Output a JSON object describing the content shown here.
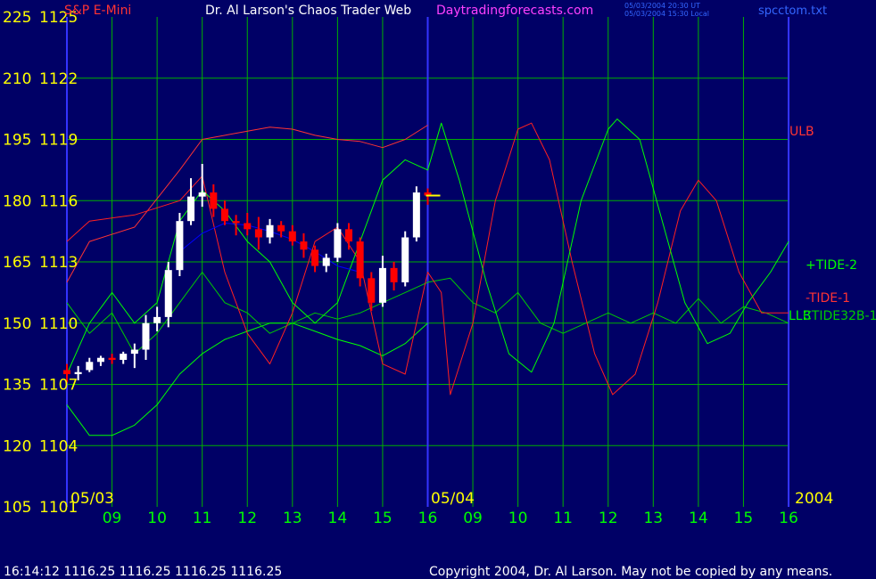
{
  "header": {
    "instrument": "S&P E-Mini",
    "site_title": "Dr. Al Larson's Chaos Trader Web",
    "site_link": "Daytradingforecasts.com",
    "stamp_line1": "05/03/2004 20:30 UT",
    "stamp_line2": "05/03/2004 15:30 Local",
    "file_name": "spcctom.txt"
  },
  "footer": {
    "quote": "16:14:12  1116.25 1116.25 1116.25 1116.25",
    "copyright": "Copyright 2004, Dr. Al Larson. May not be copied by any means."
  },
  "colors": {
    "background": "#000066",
    "grid": "#00b000",
    "divider": "#3333ff",
    "axis_text": "#ffff00",
    "hour_labels": "#00ff00",
    "ulb": "#ff3333",
    "tide_fast": "#00ff00",
    "tide_slow": "#ff2020",
    "cycle": "#00cc00",
    "bars_up": "#ffffff",
    "bars_down": "#ff0000",
    "average": "#0000ff"
  },
  "chart_data": {
    "type": "line",
    "left_axis_labels": [
      "225",
      "210",
      "195",
      "180",
      "165",
      "150",
      "135",
      "120",
      "105"
    ],
    "price_axis_labels": [
      "1125",
      "1122",
      "1119",
      "1116",
      "1113",
      "1110",
      "1107",
      "1104",
      "1101"
    ],
    "price_range": [
      1101,
      1125
    ],
    "hour_labels": [
      "09",
      "10",
      "11",
      "12",
      "13",
      "14",
      "15",
      "16",
      "09",
      "10",
      "11",
      "12",
      "13",
      "14",
      "15",
      "16"
    ],
    "date_labels": [
      "05/03",
      "05/04"
    ],
    "year_label": "2004",
    "series_labels": [
      "ULB",
      "+TIDE-2",
      "-TIDE-1",
      "LLB",
      "CTIDE32B-1"
    ],
    "last_price": 1116.25,
    "bars": [
      {
        "t": 8.0,
        "o": 1107.7,
        "h": 1108.0,
        "l": 1107.1,
        "c": 1107.5
      },
      {
        "t": 8.25,
        "o": 1107.5,
        "h": 1107.9,
        "l": 1107.2,
        "c": 1107.6
      },
      {
        "t": 8.5,
        "o": 1107.7,
        "h": 1108.3,
        "l": 1107.6,
        "c": 1108.1
      },
      {
        "t": 8.75,
        "o": 1108.1,
        "h": 1108.4,
        "l": 1107.9,
        "c": 1108.3
      },
      {
        "t": 9.0,
        "o": 1108.3,
        "h": 1108.5,
        "l": 1108.0,
        "c": 1108.2
      },
      {
        "t": 9.25,
        "o": 1108.2,
        "h": 1108.6,
        "l": 1108.0,
        "c": 1108.5
      },
      {
        "t": 9.5,
        "o": 1108.5,
        "h": 1109.0,
        "l": 1107.8,
        "c": 1108.7
      },
      {
        "t": 9.75,
        "o": 1108.7,
        "h": 1110.4,
        "l": 1108.2,
        "c": 1110.0
      },
      {
        "t": 10.0,
        "o": 1110.0,
        "h": 1110.8,
        "l": 1109.6,
        "c": 1110.3
      },
      {
        "t": 10.25,
        "o": 1110.3,
        "h": 1113.0,
        "l": 1109.8,
        "c": 1112.6
      },
      {
        "t": 10.5,
        "o": 1112.6,
        "h": 1115.4,
        "l": 1112.3,
        "c": 1115.0
      },
      {
        "t": 10.75,
        "o": 1115.0,
        "h": 1117.1,
        "l": 1114.8,
        "c": 1116.2
      },
      {
        "t": 11.0,
        "o": 1116.2,
        "h": 1117.8,
        "l": 1115.7,
        "c": 1116.4
      },
      {
        "t": 11.25,
        "o": 1116.4,
        "h": 1116.8,
        "l": 1115.2,
        "c": 1115.6
      },
      {
        "t": 11.5,
        "o": 1115.6,
        "h": 1116.0,
        "l": 1114.8,
        "c": 1115.0
      },
      {
        "t": 11.75,
        "o": 1115.0,
        "h": 1115.3,
        "l": 1114.3,
        "c": 1114.9
      },
      {
        "t": 12.0,
        "o": 1114.9,
        "h": 1115.4,
        "l": 1114.3,
        "c": 1114.6
      },
      {
        "t": 12.25,
        "o": 1114.6,
        "h": 1115.2,
        "l": 1113.6,
        "c": 1114.2
      },
      {
        "t": 12.5,
        "o": 1114.2,
        "h": 1115.1,
        "l": 1113.9,
        "c": 1114.8
      },
      {
        "t": 12.75,
        "o": 1114.8,
        "h": 1115.0,
        "l": 1114.2,
        "c": 1114.5
      },
      {
        "t": 13.0,
        "o": 1114.5,
        "h": 1114.8,
        "l": 1113.8,
        "c": 1114.0
      },
      {
        "t": 13.25,
        "o": 1114.0,
        "h": 1114.4,
        "l": 1113.2,
        "c": 1113.6
      },
      {
        "t": 13.5,
        "o": 1113.6,
        "h": 1113.8,
        "l": 1112.5,
        "c": 1112.8
      },
      {
        "t": 13.75,
        "o": 1112.8,
        "h": 1113.4,
        "l": 1112.5,
        "c": 1113.2
      },
      {
        "t": 14.0,
        "o": 1113.2,
        "h": 1114.9,
        "l": 1113.0,
        "c": 1114.6
      },
      {
        "t": 14.25,
        "o": 1114.6,
        "h": 1114.9,
        "l": 1113.6,
        "c": 1114.0
      },
      {
        "t": 14.5,
        "o": 1114.0,
        "h": 1114.2,
        "l": 1111.8,
        "c": 1112.2
      },
      {
        "t": 14.75,
        "o": 1112.2,
        "h": 1112.5,
        "l": 1110.6,
        "c": 1111.0
      },
      {
        "t": 15.0,
        "o": 1111.0,
        "h": 1113.3,
        "l": 1110.8,
        "c": 1112.7
      },
      {
        "t": 15.25,
        "o": 1112.7,
        "h": 1113.0,
        "l": 1111.6,
        "c": 1112.0
      },
      {
        "t": 15.5,
        "o": 1112.0,
        "h": 1114.5,
        "l": 1111.8,
        "c": 1114.2
      },
      {
        "t": 15.75,
        "o": 1114.2,
        "h": 1116.7,
        "l": 1114.0,
        "c": 1116.4
      },
      {
        "t": 16.0,
        "o": 1116.4,
        "h": 1116.6,
        "l": 1115.8,
        "c": 1116.25
      }
    ],
    "upper_band": [
      [
        8,
        1112
      ],
      [
        8.5,
        1114
      ],
      [
        9.5,
        1114.7
      ],
      [
        10.5,
        1117.5
      ],
      [
        11,
        1119
      ],
      [
        12,
        1119.4
      ],
      [
        12.5,
        1119.6
      ],
      [
        13,
        1119.5
      ],
      [
        13.5,
        1119.2
      ],
      [
        14,
        1119.0
      ],
      [
        14.5,
        1118.9
      ],
      [
        15,
        1118.6
      ],
      [
        15.5,
        1119
      ],
      [
        16,
        1119.7
      ]
    ],
    "lower_band": [
      [
        8,
        1106
      ],
      [
        8.5,
        1104.5
      ],
      [
        9,
        1104.5
      ],
      [
        9.5,
        1105
      ],
      [
        10,
        1106
      ],
      [
        10.5,
        1107.5
      ],
      [
        11,
        1108.5
      ],
      [
        11.5,
        1109.2
      ],
      [
        12,
        1109.6
      ],
      [
        12.5,
        1110
      ],
      [
        13,
        1110
      ],
      [
        13.5,
        1109.6
      ],
      [
        14,
        1109.2
      ],
      [
        14.5,
        1108.9
      ],
      [
        15,
        1108.4
      ],
      [
        15.5,
        1109
      ],
      [
        16,
        1110
      ]
    ],
    "fast_tide": [
      [
        8,
        1107.5
      ],
      [
        8.5,
        1110
      ],
      [
        9,
        1111.5
      ],
      [
        9.5,
        1110
      ],
      [
        10,
        1111
      ],
      [
        10.5,
        1115
      ],
      [
        11,
        1116.5
      ],
      [
        11.5,
        1115.5
      ],
      [
        12,
        1114
      ],
      [
        12.5,
        1113
      ],
      [
        13,
        1111
      ],
      [
        13.5,
        1110
      ],
      [
        14,
        1111
      ],
      [
        14.5,
        1114
      ],
      [
        15,
        1117
      ],
      [
        15.5,
        1118
      ],
      [
        16,
        1117.5
      ],
      [
        16.3,
        1119.8
      ],
      [
        16.7,
        1117
      ],
      [
        17.3,
        1112
      ],
      [
        17.8,
        1108.5
      ],
      [
        18.3,
        1107.6
      ],
      [
        18.8,
        1110
      ],
      [
        19.4,
        1116
      ],
      [
        20,
        1119.5
      ],
      [
        20.2,
        1120
      ],
      [
        20.7,
        1119
      ],
      [
        21.2,
        1115
      ],
      [
        21.7,
        1111
      ],
      [
        22.2,
        1109
      ],
      [
        22.7,
        1109.5
      ],
      [
        23.1,
        1111
      ],
      [
        23.6,
        1112.5
      ],
      [
        24,
        1114
      ]
    ],
    "slow_tide": [
      [
        8,
        1114
      ],
      [
        8.5,
        1115
      ],
      [
        9.5,
        1115.3
      ],
      [
        10.5,
        1116
      ],
      [
        11,
        1117.2
      ],
      [
        11.5,
        1112.5
      ],
      [
        12,
        1109.5
      ],
      [
        12.5,
        1108
      ],
      [
        13,
        1110.5
      ],
      [
        13.5,
        1114
      ],
      [
        14,
        1114.7
      ],
      [
        14.5,
        1113
      ],
      [
        15,
        1108
      ],
      [
        15.5,
        1107.5
      ],
      [
        16,
        1112.5
      ],
      [
        16.3,
        1111.5
      ],
      [
        16.5,
        1106.5
      ],
      [
        17,
        1110
      ],
      [
        17.5,
        1116
      ],
      [
        18,
        1119.5
      ],
      [
        18.3,
        1119.8
      ],
      [
        18.7,
        1118
      ],
      [
        19.2,
        1113
      ],
      [
        19.7,
        1108.5
      ],
      [
        20.1,
        1106.5
      ],
      [
        20.6,
        1107.5
      ],
      [
        21.1,
        1111
      ],
      [
        21.6,
        1115.5
      ],
      [
        22,
        1117
      ],
      [
        22.4,
        1116
      ],
      [
        22.9,
        1112.5
      ],
      [
        23.4,
        1110.5
      ],
      [
        24,
        1110.5
      ]
    ],
    "cycle_line": [
      [
        8,
        1111
      ],
      [
        8.5,
        1109.5
      ],
      [
        9,
        1110.5
      ],
      [
        9.5,
        1108.5
      ],
      [
        10,
        1109.5
      ],
      [
        10.5,
        1111
      ],
      [
        11,
        1112.5
      ],
      [
        11.5,
        1111
      ],
      [
        12,
        1110.5
      ],
      [
        12.5,
        1109.5
      ],
      [
        13,
        1110
      ],
      [
        13.5,
        1110.5
      ],
      [
        14,
        1110.2
      ],
      [
        14.5,
        1110.5
      ],
      [
        15,
        1111
      ],
      [
        15.5,
        1111.5
      ],
      [
        16,
        1112
      ],
      [
        16.5,
        1112.2
      ],
      [
        17,
        1111
      ],
      [
        17.5,
        1110.5
      ],
      [
        18,
        1111.5
      ],
      [
        18.5,
        1110
      ],
      [
        19,
        1109.5
      ],
      [
        19.5,
        1110
      ],
      [
        20,
        1110.5
      ],
      [
        20.5,
        1110
      ],
      [
        21,
        1110.5
      ],
      [
        21.5,
        1110
      ],
      [
        22,
        1111.2
      ],
      [
        22.5,
        1110
      ],
      [
        23,
        1110.8
      ],
      [
        23.5,
        1110.5
      ],
      [
        24,
        1110
      ]
    ],
    "average_line": [
      [
        10.5,
        1113.5
      ],
      [
        11,
        1114.4
      ],
      [
        11.5,
        1114.9
      ],
      [
        12,
        1114.8
      ],
      [
        12.5,
        1114.5
      ],
      [
        13,
        1114.1
      ],
      [
        13.5,
        1113.5
      ],
      [
        14,
        1112.8
      ],
      [
        14.5,
        1112.5
      ]
    ]
  }
}
